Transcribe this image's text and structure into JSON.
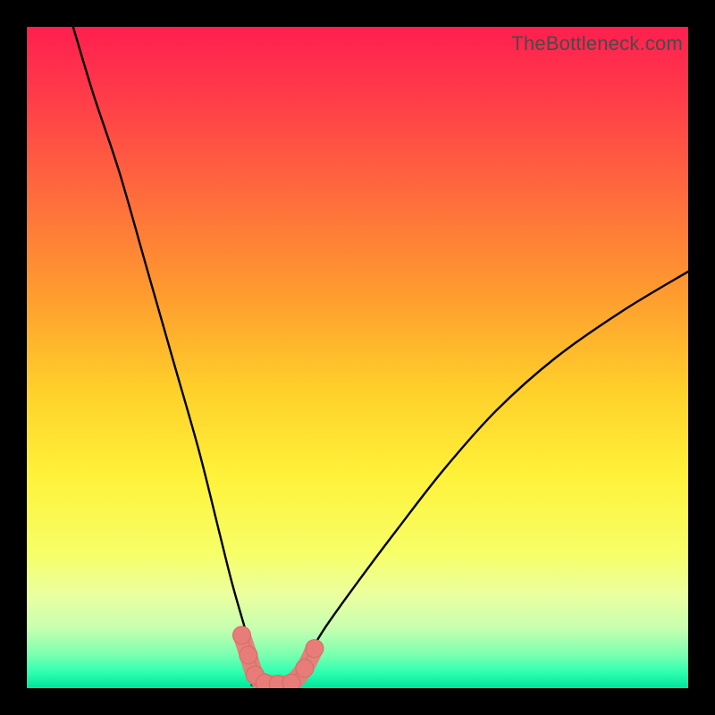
{
  "watermark": "TheBottleneck.com",
  "colors": {
    "frame": "#000000",
    "curve": "#000000",
    "marker_fill": "#e87c78",
    "marker_stroke": "#d86a66",
    "gradient_stops": [
      {
        "offset": 0.0,
        "color": "#ff1f4f"
      },
      {
        "offset": 0.1,
        "color": "#ff3a4a"
      },
      {
        "offset": 0.25,
        "color": "#ff6a3d"
      },
      {
        "offset": 0.4,
        "color": "#ff9a2f"
      },
      {
        "offset": 0.55,
        "color": "#ffd02a"
      },
      {
        "offset": 0.68,
        "color": "#fff23a"
      },
      {
        "offset": 0.8,
        "color": "#f6ff6a"
      },
      {
        "offset": 0.86,
        "color": "#eaffa0"
      },
      {
        "offset": 0.91,
        "color": "#c6ffb0"
      },
      {
        "offset": 0.95,
        "color": "#7affb0"
      },
      {
        "offset": 0.975,
        "color": "#30ffb0"
      },
      {
        "offset": 1.0,
        "color": "#00e59a"
      }
    ]
  },
  "chart_data": {
    "type": "line",
    "title": "",
    "xlabel": "",
    "ylabel": "",
    "xlim": [
      0,
      100
    ],
    "ylim": [
      0,
      100
    ],
    "note": "V-shaped bottleneck curve; y is mismatch %, minimum ~0 near x≈37. Values estimated from pixel positions; no axis ticks shown.",
    "series": [
      {
        "name": "left-branch",
        "x": [
          7,
          10,
          14,
          18,
          22,
          26,
          29,
          31,
          33,
          34.5,
          36
        ],
        "values": [
          100,
          90,
          78,
          64,
          50,
          36,
          24,
          16,
          9,
          4,
          1
        ]
      },
      {
        "name": "right-branch",
        "x": [
          40,
          42,
          45,
          50,
          56,
          63,
          71,
          80,
          90,
          100
        ],
        "values": [
          1,
          4,
          9,
          16,
          24,
          33,
          42,
          50,
          57,
          63
        ]
      }
    ],
    "floor": {
      "name": "valley-floor",
      "x_range": [
        34,
        41
      ],
      "y": 0.5
    },
    "markers": [
      {
        "x": 32.5,
        "y": 8
      },
      {
        "x": 33.5,
        "y": 5
      },
      {
        "x": 34.5,
        "y": 2
      },
      {
        "x": 36.0,
        "y": 0.8
      },
      {
        "x": 38.0,
        "y": 0.6
      },
      {
        "x": 40.0,
        "y": 0.8
      },
      {
        "x": 42.0,
        "y": 3
      },
      {
        "x": 43.5,
        "y": 6
      }
    ]
  }
}
